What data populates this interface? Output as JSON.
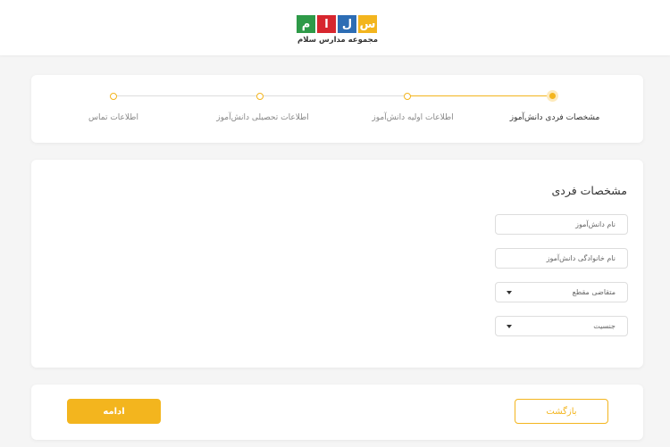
{
  "header": {
    "logo": {
      "letters": [
        "م",
        "ا",
        "ل",
        "س"
      ],
      "text": "مجموعه مدارس سلام"
    }
  },
  "steps": [
    {
      "label": "مشخصات فردی دانش‌آموز",
      "active": true
    },
    {
      "label": "اطلاعات اولیه دانش‌آموز",
      "active": false
    },
    {
      "label": "اطلاعات تحصیلی دانش‌آموز",
      "active": false
    },
    {
      "label": "اطلاعات تماس",
      "active": false
    }
  ],
  "form": {
    "title": "مشخصات فردی",
    "first_name_placeholder": "نام دانش‌آموز",
    "last_name_placeholder": "نام خانوادگی دانش‌آموز",
    "grade_select": "متقاضی مقطع",
    "gender_select": "جنسیت"
  },
  "actions": {
    "continue_label": "ادامه",
    "back_label": "بازگشت"
  },
  "colors": {
    "accent": "#f3b51e",
    "logo_green": "#2e9a48",
    "logo_red": "#d7262e",
    "logo_blue": "#2d6db4",
    "logo_yellow": "#f3b51e"
  }
}
